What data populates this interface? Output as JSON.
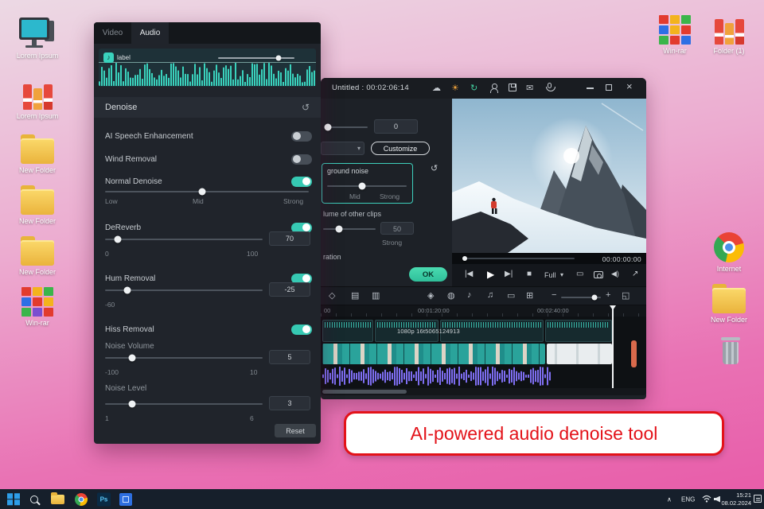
{
  "colors": {
    "accent_teal": "#3ad2bd",
    "ok_green": "#3ed3a8",
    "callout_red": "#e31219",
    "timeline_purple": "#7e6ef2"
  },
  "desktop": {
    "icons_left": [
      {
        "label": "Lorem Ipsum"
      },
      {
        "label": "Lorem Ipsum"
      },
      {
        "label": "New Folder"
      },
      {
        "label": "New Folder"
      },
      {
        "label": "New Folder"
      },
      {
        "label": "Win-rar"
      }
    ],
    "icons_top_right": [
      {
        "label": "Win-rar"
      },
      {
        "label": "Folder (1)"
      }
    ],
    "icons_right": [
      {
        "label": "Internet"
      },
      {
        "label": "New Folder"
      }
    ]
  },
  "panel": {
    "tabs": {
      "video": "Video",
      "audio": "Audio"
    },
    "clip_chip": "label",
    "denoise_title": "Denoise",
    "ai_speech": "AI Speech Enhancement",
    "wind": "Wind Removal",
    "normal": "Normal Denoise",
    "normal_marks": {
      "low": "Low",
      "mid": "Mid",
      "strong": "Strong"
    },
    "dereverb": {
      "label": "DeReverb",
      "value": "70",
      "min": "0",
      "max": "100"
    },
    "hum": {
      "label": "Hum Removal",
      "value": "-25",
      "min": "-60"
    },
    "hiss": "Hiss Removal",
    "noise_volume": {
      "label": "Noise Volume",
      "value": "5",
      "min": "-100",
      "max": "10"
    },
    "noise_level": {
      "label": "Noise Level",
      "value": "3",
      "min": "1",
      "max": "6"
    },
    "reset": "Reset"
  },
  "window": {
    "title": "Untitled : 00:02:06:14",
    "settings": {
      "top_value": "0",
      "customize": "Customize",
      "box_label": "ground noise",
      "mark_mid": "Mid",
      "mark_strong": "Strong",
      "clips_label": "lume of other clips",
      "clips_value": "50",
      "clips_mark": "Strong",
      "ration": "ration",
      "ok": "OK"
    },
    "preview_time": "00:00:00:00",
    "transport_full": "Full",
    "ruler": [
      "00",
      "00:01:20:00",
      "00:02:40:00"
    ],
    "clip_text": "1080p 16t5065124913"
  },
  "callout": "AI-powered audio denoise tool",
  "taskbar": {
    "lang": "ENG",
    "time": "15:21",
    "date": "08.02.2024",
    "ps": "Ps"
  },
  "icons": {
    "music_note": "♪",
    "reset": "↺",
    "cloud": "☁",
    "sun": "☀",
    "refresh": "↻",
    "mail": "✉",
    "close": "×",
    "prev": "|◀",
    "play": "▶",
    "next": "▶|",
    "stop": "■",
    "caret_down": "▾",
    "screen": "▭",
    "expand": "↗",
    "speaker": "◀)",
    "keyframe": "◇",
    "adjust": "▤",
    "mixer": "▥",
    "effects": "◈",
    "record": "◍",
    "note1": "♪",
    "note2": "♫",
    "grid": "⊞",
    "minus": "−",
    "plus": "+",
    "fit": "◱",
    "chevron_up": "∧"
  }
}
